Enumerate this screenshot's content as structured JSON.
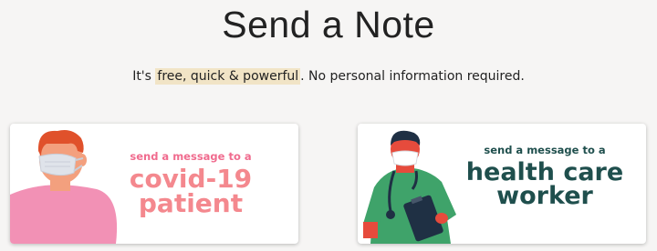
{
  "header": {
    "title": "Send a Note",
    "subtitle_prefix": "It's ",
    "subtitle_highlight": "free, quick & powerful",
    "subtitle_suffix": ". No personal information required."
  },
  "cards": [
    {
      "small_label": "send a message to a",
      "big_line1": "covid-19",
      "big_line2": "patient",
      "illustration": "masked-person-icon",
      "accent_color": "#f4888e"
    },
    {
      "small_label": "send a message to a",
      "big_line1": "health care",
      "big_line2": "worker",
      "illustration": "masked-doctor-icon",
      "accent_color": "#1f4f4d"
    }
  ]
}
